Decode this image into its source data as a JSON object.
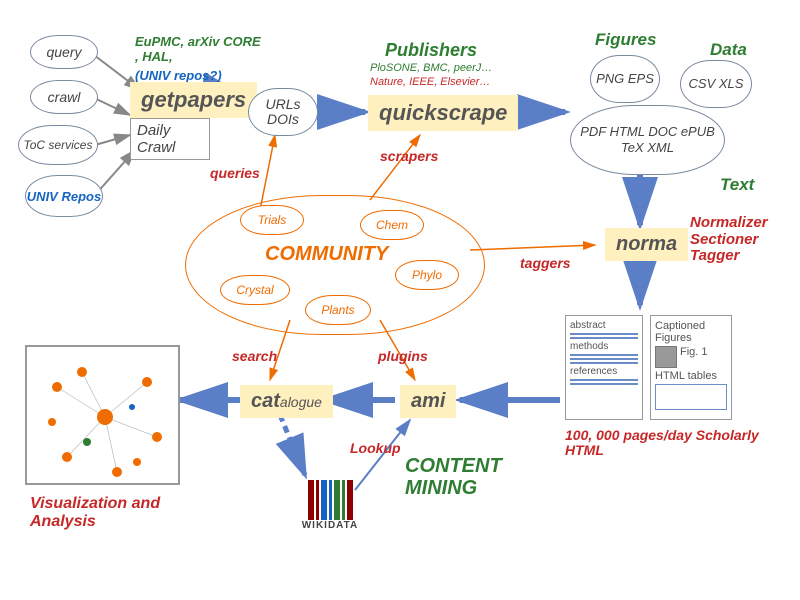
{
  "inputs": {
    "query": "query",
    "crawl": "crawl",
    "toc": "ToC services",
    "univ": "UNIV Repos"
  },
  "getpapers": {
    "label": "getpapers",
    "sources_green": "EuPMC, arXiv CORE , HAL,",
    "sources_blue": "(UNIV repos?)",
    "daily_crawl": "Daily Crawl",
    "urls": "URLs DOIs"
  },
  "quickscrape": {
    "label": "quickscrape",
    "publishers_title": "Publishers",
    "publishers_green": "PloSONE, BMC, peerJ…",
    "publishers_red": "Nature, IEEE, Elsevier…"
  },
  "outputs": {
    "figures_title": "Figures",
    "data_title": "Data",
    "text_title": "Text",
    "fig_formats": "PNG EPS",
    "data_formats": "CSV XLS",
    "text_formats": "PDF HTML DOC ePUB TeX XML"
  },
  "norma": {
    "label": "norma",
    "roles": "Normalizer Sectioner Tagger"
  },
  "docs": {
    "abstract": "abstract",
    "methods": "methods",
    "references": "references",
    "captioned": "Captioned Figures",
    "fig1": "Fig. 1",
    "tables": "HTML tables",
    "rate": "100, 000 pages/day Scholarly HTML"
  },
  "ami": {
    "label": "ami"
  },
  "catalogue": {
    "label_cat": "cat",
    "label_rest": "alogue"
  },
  "community": {
    "title": "COMMUNITY",
    "trials": "Trials",
    "chem": "Chem",
    "crystal": "Crystal",
    "plants": "Plants",
    "phylo": "Phylo",
    "queries": "queries",
    "scrapers": "scrapers",
    "taggers": "taggers",
    "plugins": "plugins",
    "search": "search",
    "lookup": "Lookup"
  },
  "viz": {
    "label": "Visualization and Analysis"
  },
  "content_mining": "CONTENT MINING",
  "wikidata": "WIKIDATA"
}
